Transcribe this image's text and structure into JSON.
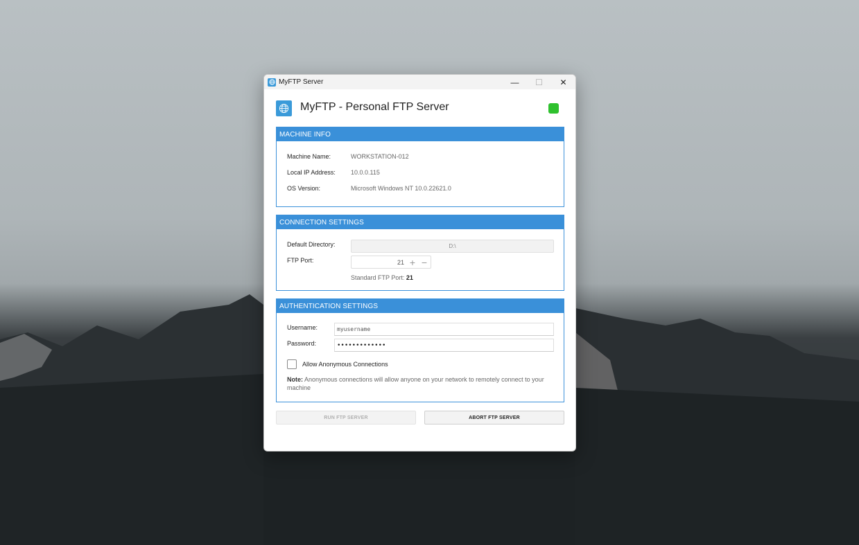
{
  "window": {
    "title": "MyFTP Server",
    "controls": {
      "minimize": "—",
      "maximize": "☐",
      "close": "✕"
    }
  },
  "header": {
    "app_title": "MyFTP - Personal FTP Server",
    "status_color": "#2fc12e"
  },
  "machine_info": {
    "heading": "MACHINE INFO",
    "rows": [
      {
        "label": "Machine Name:",
        "value": "WORKSTATION-012"
      },
      {
        "label": "Local IP Address:",
        "value": "10.0.0.115"
      },
      {
        "label": "OS Version:",
        "value": "Microsoft Windows NT 10.0.22621.0"
      }
    ]
  },
  "connection_settings": {
    "heading": "CONNECTION SETTINGS",
    "default_directory_label": "Default Directory:",
    "default_directory_value": "D:\\",
    "ftp_port_label": "FTP Port:",
    "ftp_port_value": "21",
    "standard_port_prefix": "Standard FTP Port: ",
    "standard_port_value": "21"
  },
  "authentication_settings": {
    "heading": "AUTHENTICATION SETTINGS",
    "username_label": "Username:",
    "username_value": "myusername",
    "password_label": "Password:",
    "password_value": "•••••••••••••",
    "anonymous_label": "Allow Anonymous Connections",
    "anonymous_checked": false,
    "note_prefix": "Note:",
    "note_text": " Anonymous connections will allow anyone on your network to remotely connect to your machine"
  },
  "buttons": {
    "run": "RUN FTP SERVER",
    "abort": "ABORT FTP SERVER"
  },
  "colors": {
    "accent": "#3a90d9",
    "status_ok": "#2fc12e"
  },
  "icons": {
    "app": "globe-icon",
    "plus": "plus-icon",
    "minus": "minus-icon"
  }
}
